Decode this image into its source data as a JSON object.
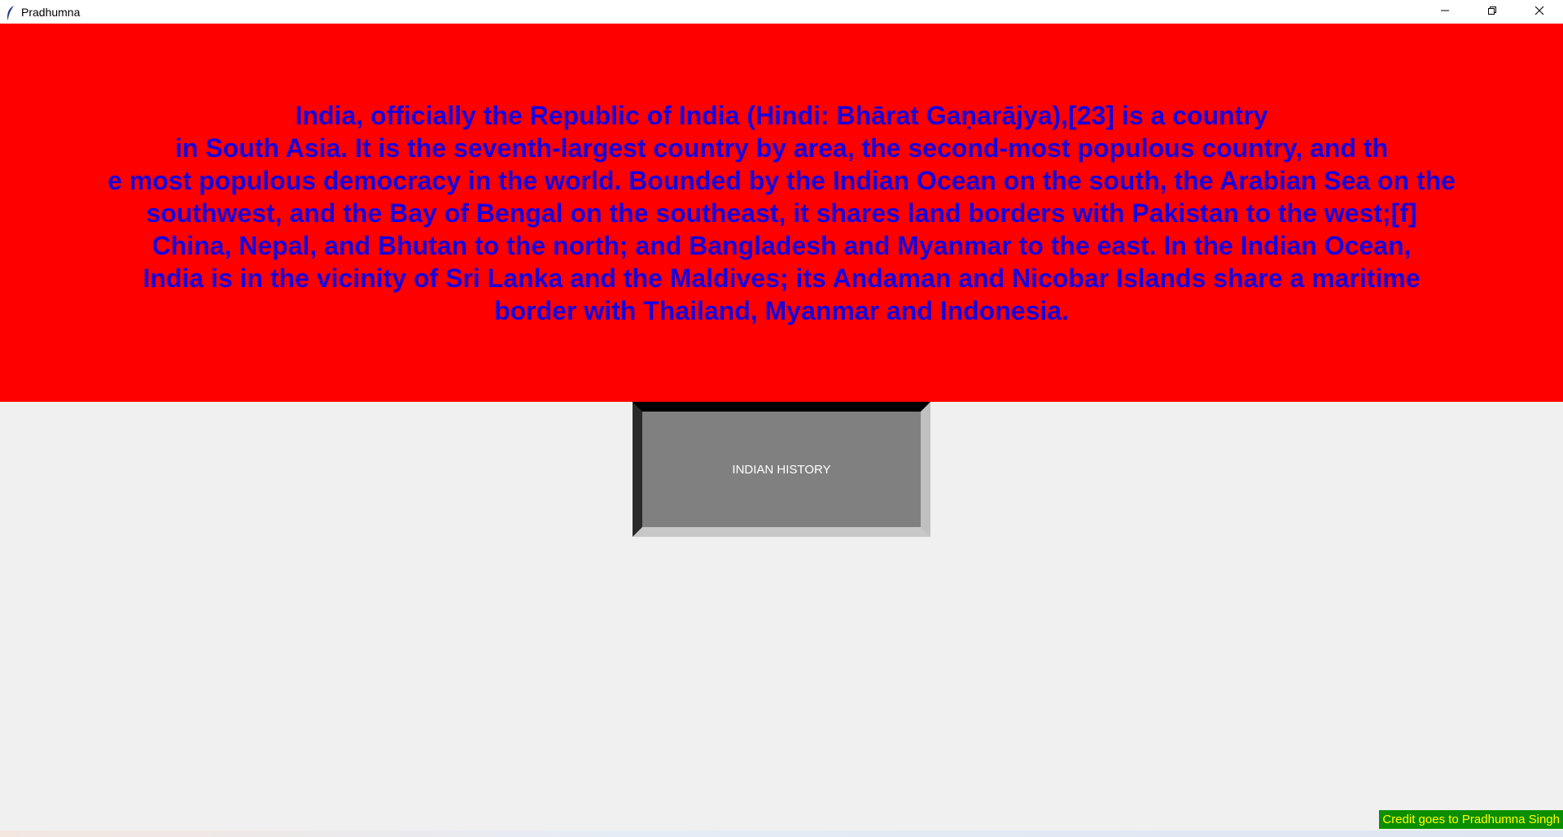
{
  "window": {
    "title": "Pradhumna",
    "minimize_icon": "minimize-icon",
    "restore_icon": "restore-icon",
    "close_icon": "close-icon"
  },
  "banner": {
    "background": "#ff0000",
    "text_color": "#1a00d8",
    "lines": [
      "India, officially the Republic of India (Hindi: Bhārat Gaṇarājya),[23] is a country",
      "in South Asia. It is the seventh-largest country by area, the second-most populous country, and th",
      "e most populous democracy in the world. Bounded by the Indian Ocean on the south, the Arabian Sea on the",
      "southwest, and the Bay of Bengal on the southeast, it shares land borders with Pakistan to the west;[f]",
      "China, Nepal, and Bhutan to the north; and Bangladesh and Myanmar to the east. In the Indian Ocean,",
      "India is in the vicinity of Sri Lanka and the Maldives; its Andaman and Nicobar Islands share a maritime",
      "border with Thailand, Myanmar and Indonesia."
    ]
  },
  "history_button": {
    "label": "INDIAN HISTORY"
  },
  "credit": {
    "text": "Credit goes to Pradhumna Singh"
  }
}
